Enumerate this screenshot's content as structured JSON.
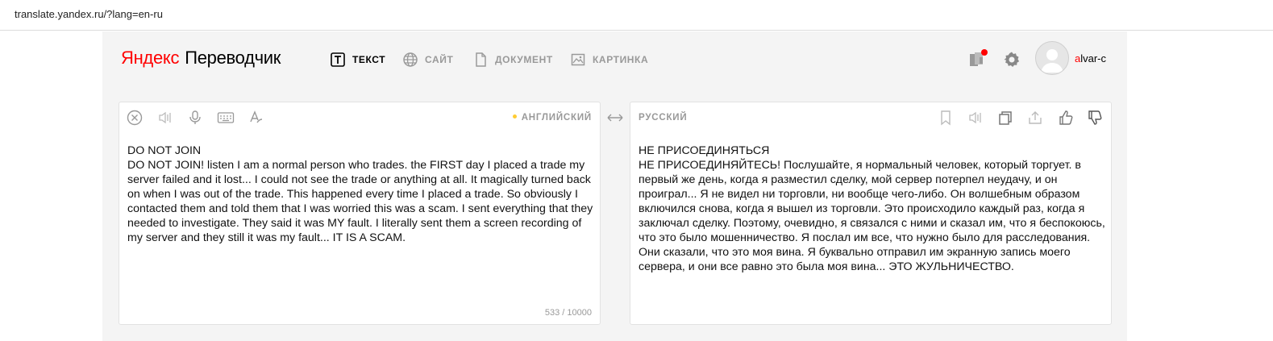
{
  "browser": {
    "url": "translate.yandex.ru/?lang=en-ru"
  },
  "header": {
    "logo_brand": "Яндекс",
    "logo_product": "Переводчик",
    "tabs": [
      {
        "label": "ТЕКСТ",
        "icon": "text-icon",
        "active": true
      },
      {
        "label": "САЙТ",
        "icon": "globe-icon",
        "active": false
      },
      {
        "label": "ДОКУМЕНТ",
        "icon": "document-icon",
        "active": false
      },
      {
        "label": "КАРТИНКА",
        "icon": "image-icon",
        "active": false
      }
    ],
    "user": {
      "name_first": "a",
      "name_rest": "lvar-c"
    }
  },
  "source": {
    "language": "АНГЛИЙСКИЙ",
    "text": "DO NOT JOIN\nDO NOT JOIN! listen I am a normal person who trades. the FIRST day I placed a trade my server failed and it lost... I could not see the trade or anything at all. It magically turned back on when I was out of the trade. This happened every time I placed a trade. So obviously I contacted them and told them that I was worried this was a scam. I sent everything that they needed to investigate. They said it was MY fault. I literally sent them a screen recording of my server and they still it was my fault... IT IS A SCAM.",
    "counter": "533 / 10000"
  },
  "target": {
    "language": "РУССКИЙ",
    "text": "НЕ ПРИСОЕДИНЯТЬСЯ\nНЕ ПРИСОЕДИНЯЙТЕСЬ! Послушайте, я нормальный человек, который торгует. в первый же день, когда я разместил сделку, мой сервер потерпел неудачу, и он проиграл... Я не видел ни торговли, ни вообще чего-либо. Он волшебным образом включился снова, когда я вышел из торговли. Это происходило каждый раз, когда я заключал сделку. Поэтому, очевидно, я связался с ними и сказал им, что я беспокоюсь, что это было мошенничество. Я послал им все, что нужно было для расследования. Они сказали, что это моя вина. Я буквально отправил им экранную запись моего сервера, и они все равно это была моя вина... ЭТО ЖУЛЬНИЧЕСТВО."
  },
  "colors": {
    "brand_red": "#ff0000",
    "accent_yellow": "#ffcc33",
    "muted": "#999999"
  }
}
